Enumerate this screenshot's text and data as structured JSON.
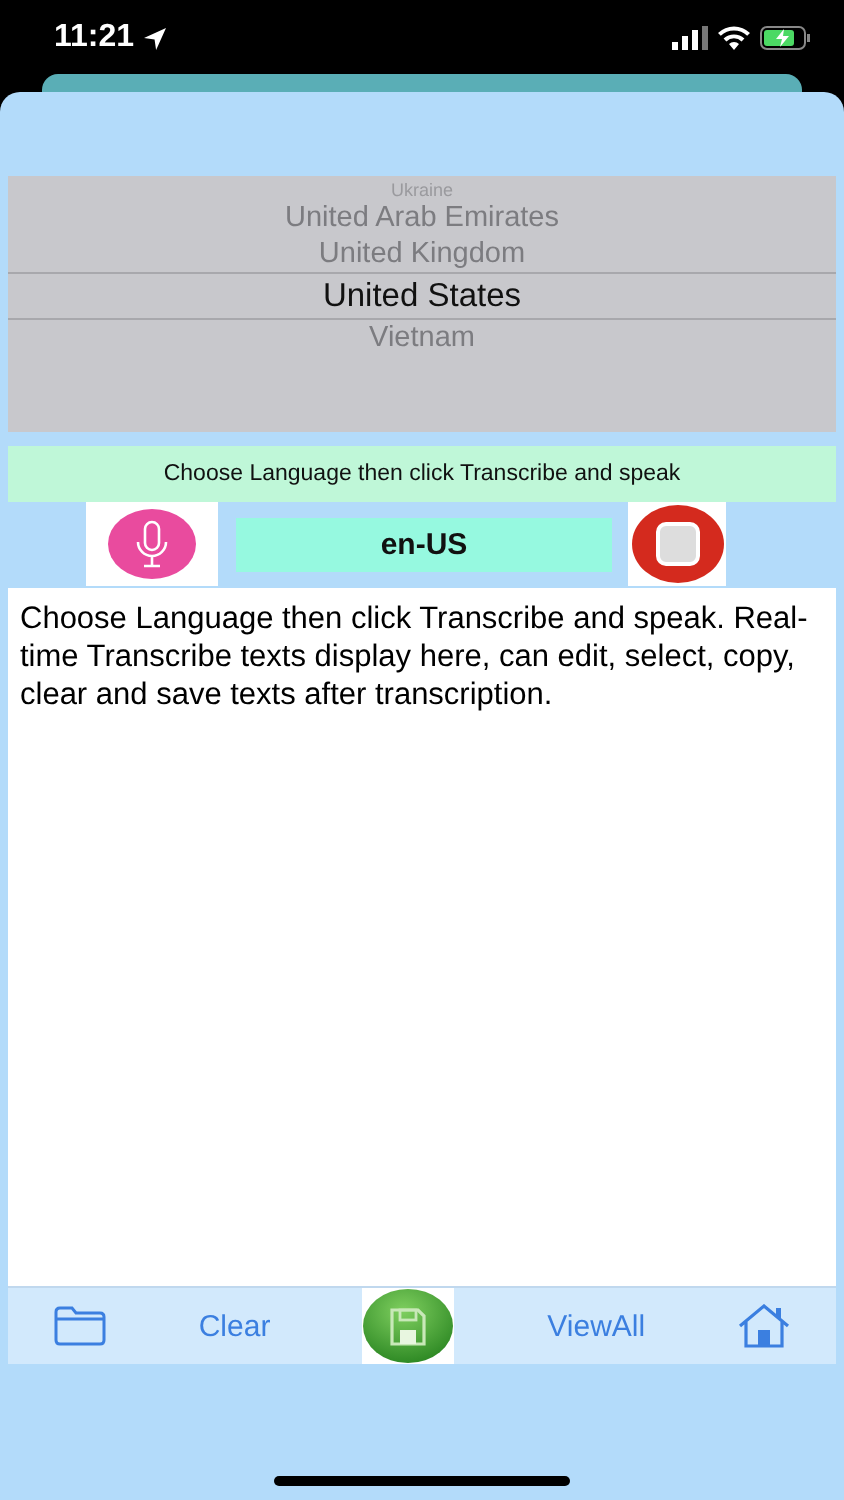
{
  "status_bar": {
    "time": "11:21"
  },
  "picker": {
    "items": [
      {
        "label": "Ukraine",
        "selected": false
      },
      {
        "label": "United Arab Emirates",
        "selected": false
      },
      {
        "label": "United Kingdom",
        "selected": false
      },
      {
        "label": "United States",
        "selected": true
      },
      {
        "label": "Vietnam",
        "selected": false
      }
    ]
  },
  "banner": "Choose Language then click Transcribe and speak",
  "language_code": "en-US",
  "transcript": "Choose Language then click Transcribe and speak. Real-time Transcribe texts display here, can edit, select, copy, clear and save texts after transcription.",
  "toolbar": [
    {
      "kind": "folder"
    },
    {
      "kind": "text",
      "label": "Clear"
    },
    {
      "kind": "save"
    },
    {
      "kind": "text",
      "label": "ViewAll"
    },
    {
      "kind": "home"
    }
  ]
}
